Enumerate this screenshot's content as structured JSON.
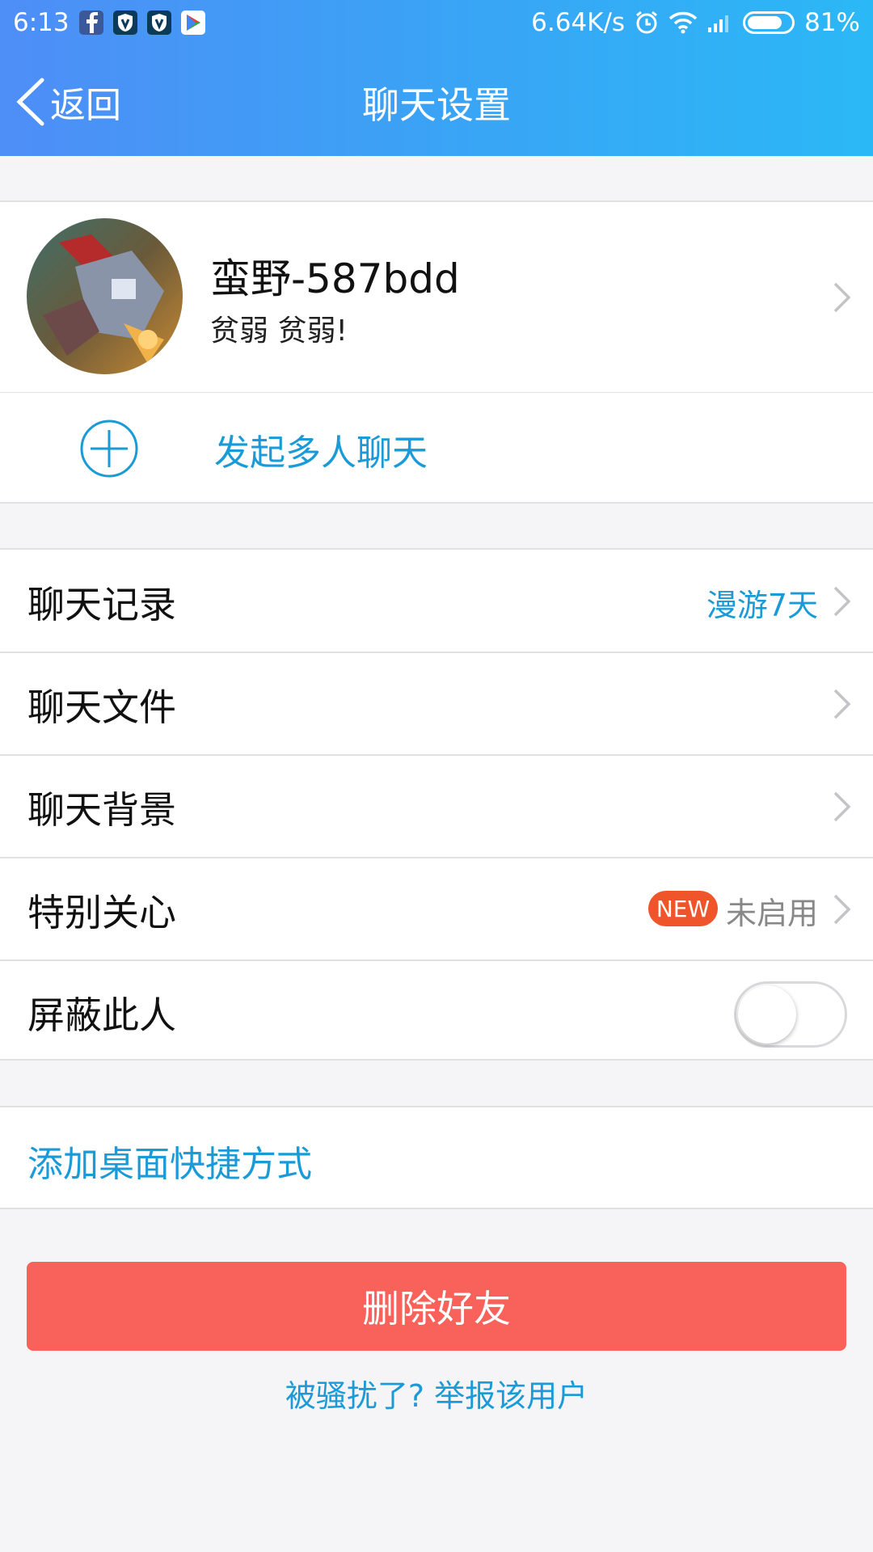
{
  "status_bar": {
    "time": "6:13",
    "network_speed": "6.64K/s",
    "battery": "81%",
    "battery_level": 0.81,
    "notification_icons": [
      "facebook-icon",
      "shield-app-icon",
      "shield-app-icon",
      "play-store-icon"
    ]
  },
  "nav": {
    "back_label": "返回",
    "title": "聊天设置"
  },
  "profile": {
    "name": "蛮野-587bdd",
    "signature": "贫弱 贫弱!"
  },
  "group_chat": {
    "label": "发起多人聊天"
  },
  "settings": {
    "rows": [
      {
        "label": "聊天记录",
        "value": "漫游7天",
        "value_color": "#1a9ad6"
      },
      {
        "label": "聊天文件",
        "value": ""
      },
      {
        "label": "聊天背景",
        "value": ""
      },
      {
        "label": "特别关心",
        "badge": "NEW",
        "value": "未启用",
        "value_color": "#888888"
      },
      {
        "label": "屏蔽此人",
        "toggle_on": false
      }
    ]
  },
  "shortcut": {
    "label": "添加桌面快捷方式"
  },
  "actions": {
    "delete_label": "删除好友",
    "report_label": "被骚扰了? 举报该用户"
  },
  "colors": {
    "accent": "#1a9ad6",
    "danger": "#f9625a",
    "badge": "#f0542b",
    "header_start": "#4e8ef7",
    "header_end": "#2bb8f6"
  }
}
